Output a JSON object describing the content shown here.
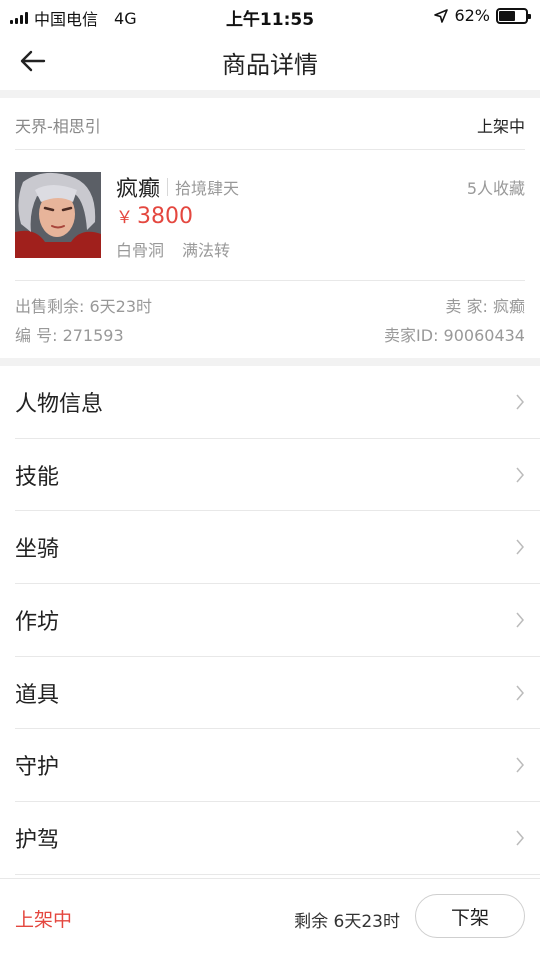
{
  "status_bar": {
    "carrier": "中国电信",
    "network": "4G",
    "time": "上午11:55",
    "battery": "62%",
    "battery_level": 0.62
  },
  "nav": {
    "title": "商品详情"
  },
  "listing": {
    "server": "天界-相思引",
    "status": "上架中",
    "name": "疯癫",
    "realm": "拾境肆天",
    "favorites": "5人收藏",
    "price_symbol": "￥",
    "price": "3800",
    "tags": [
      "白骨洞",
      "满法转"
    ],
    "time_left": "出售剩余: 6天23时",
    "seller": "卖  家: 疯癫",
    "serial": "编  号: 271593",
    "seller_id": "卖家ID: 90060434"
  },
  "menu": [
    {
      "label": "人物信息"
    },
    {
      "label": "技能"
    },
    {
      "label": "坐骑"
    },
    {
      "label": "作坊"
    },
    {
      "label": "道具"
    },
    {
      "label": "守护"
    },
    {
      "label": "护驾"
    }
  ],
  "bottom_bar": {
    "status": "上架中",
    "remaining": "剩余 6天23时",
    "action": "下架"
  },
  "colors": {
    "accent_red": "#e4473f",
    "muted_text": "#999999",
    "divider": "#e8e8e8"
  }
}
